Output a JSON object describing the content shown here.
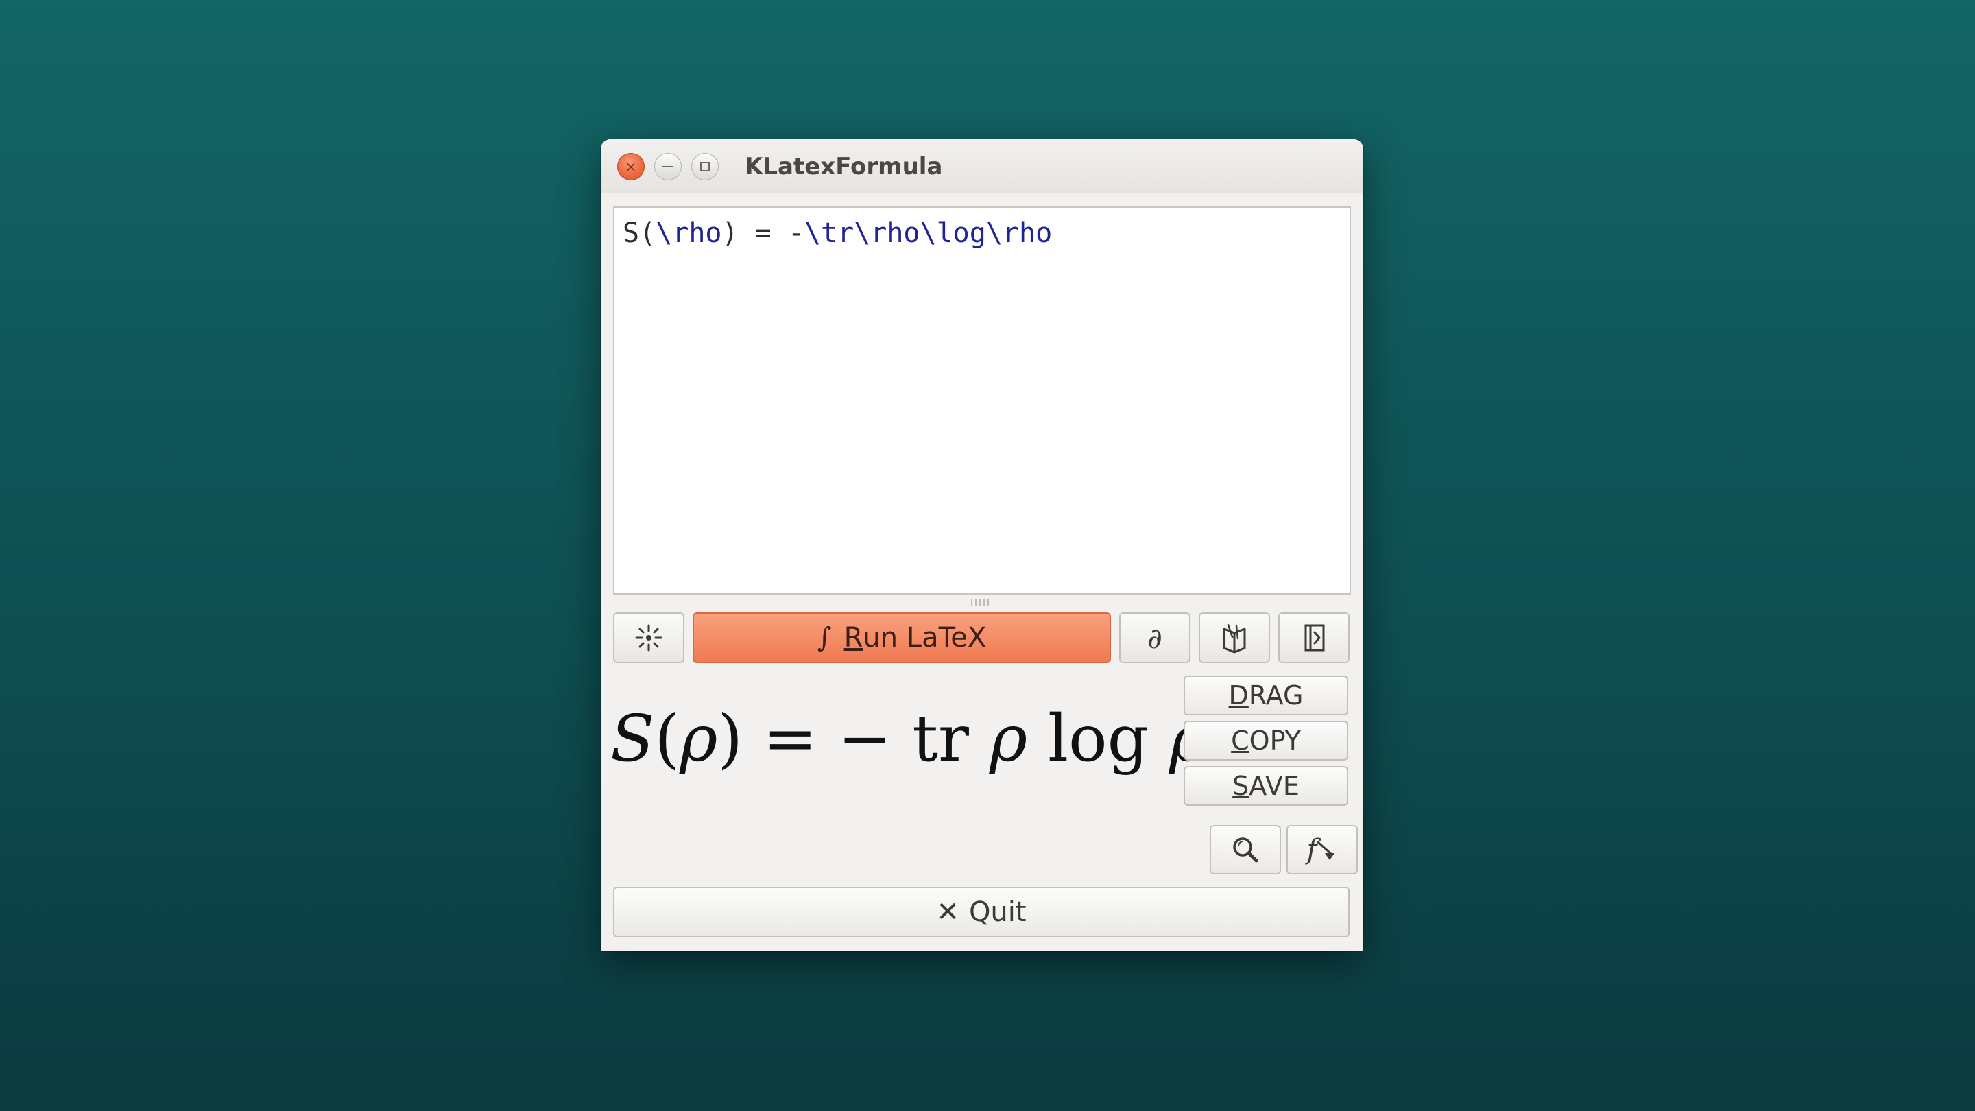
{
  "window": {
    "title": "KLatexFormula",
    "close_glyph": "×",
    "close_icon": "close-icon",
    "minimize_icon": "minimize-icon",
    "maximize_icon": "maximize-icon"
  },
  "editor": {
    "latex_parts": [
      {
        "text": "S(",
        "kind": "plain"
      },
      {
        "text": "\\rho",
        "kind": "cmd"
      },
      {
        "text": ") = -",
        "kind": "plain"
      },
      {
        "text": "\\tr\\rho\\log\\rho",
        "kind": "cmd"
      }
    ]
  },
  "toolbar": {
    "settings_icon": "settings-sparkle-icon",
    "run_glyph": "∫",
    "run_label_mnemonic": "R",
    "run_label_rest": "un LaTeX",
    "symbols_glyph": "∂",
    "library_icon": "library-book-icon",
    "expand_icon": "expand-panel-icon"
  },
  "preview": {
    "S": "S",
    "open": "(",
    "rho1": "ρ",
    "close": ")",
    "eq": " = ",
    "minus": "− ",
    "tr": "tr ",
    "rho2": "ρ",
    "log": " log ",
    "rho3": "ρ"
  },
  "actions": {
    "drag_mnemonic": "D",
    "drag_rest": "RAG",
    "copy_mnemonic": "C",
    "copy_rest": "OPY",
    "save_mnemonic": "S",
    "save_rest": "AVE"
  },
  "tools": {
    "zoom_icon": "magnifier-icon",
    "style_glyph": "f",
    "style_icon": "style-dropdown-icon"
  },
  "quit": {
    "glyph": "✕",
    "label": "Quit"
  },
  "colors": {
    "accent": "#f07a50",
    "latex_command": "#1f2494",
    "background": "#136566"
  }
}
